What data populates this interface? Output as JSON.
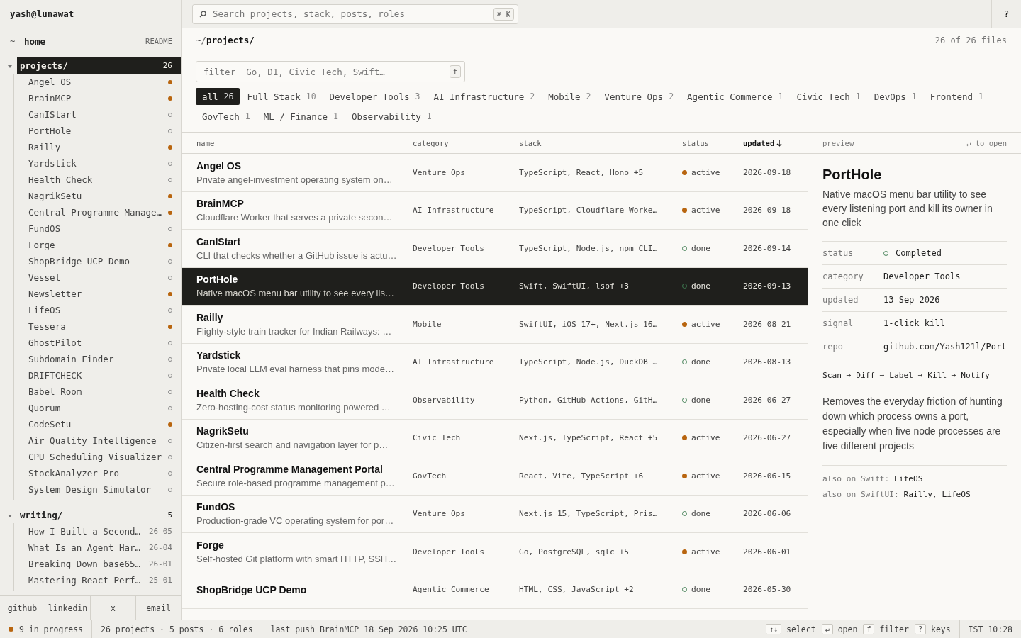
{
  "topbar": {
    "user": "yash@lunawat",
    "search": {
      "placeholder": "Search projects, stack, posts, roles",
      "shortcut": "⌘ K"
    },
    "help": "?"
  },
  "sidebar": {
    "home": {
      "icon": "~",
      "label": "home",
      "link": "README"
    },
    "sections": [
      {
        "label": "projects/",
        "count": "26",
        "expanded": true,
        "selected": true,
        "items": [
          {
            "kind": "project",
            "name": "Angel OS",
            "active": true
          },
          {
            "kind": "project",
            "name": "BrainMCP",
            "active": true
          },
          {
            "kind": "project",
            "name": "CanIStart",
            "active": false
          },
          {
            "kind": "project",
            "name": "PortHole",
            "active": false
          },
          {
            "kind": "project",
            "name": "Railly",
            "active": true
          },
          {
            "kind": "project",
            "name": "Yardstick",
            "active": false
          },
          {
            "kind": "project",
            "name": "Health Check",
            "active": false
          },
          {
            "kind": "project",
            "name": "NagrikSetu",
            "active": true
          },
          {
            "kind": "project",
            "name": "Central Programme Manage…",
            "active": true
          },
          {
            "kind": "project",
            "name": "FundOS",
            "active": false
          },
          {
            "kind": "project",
            "name": "Forge",
            "active": true
          },
          {
            "kind": "project",
            "name": "ShopBridge UCP Demo",
            "active": false
          },
          {
            "kind": "project",
            "name": "Vessel",
            "active": false
          },
          {
            "kind": "project",
            "name": "Newsletter",
            "active": true
          },
          {
            "kind": "project",
            "name": "LifeOS",
            "active": false
          },
          {
            "kind": "project",
            "name": "Tessera",
            "active": true
          },
          {
            "kind": "project",
            "name": "GhostPilot",
            "active": false
          },
          {
            "kind": "project",
            "name": "Subdomain Finder",
            "active": false
          },
          {
            "kind": "project",
            "name": "DRIFTCHECK",
            "active": false
          },
          {
            "kind": "project",
            "name": "Babel Room",
            "active": false
          },
          {
            "kind": "project",
            "name": "Quorum",
            "active": false
          },
          {
            "kind": "project",
            "name": "CodeSetu",
            "active": true
          },
          {
            "kind": "project",
            "name": "Air Quality Intelligence",
            "active": false
          },
          {
            "kind": "project",
            "name": "CPU Scheduling Visualizer",
            "active": false
          },
          {
            "kind": "project",
            "name": "StockAnalyzer Pro",
            "active": false
          },
          {
            "kind": "project",
            "name": "System Design Simulator",
            "active": false
          }
        ]
      },
      {
        "label": "writing/",
        "count": "5",
        "expanded": true,
        "selected": false,
        "items": [
          {
            "kind": "post",
            "name": "How I Built a Second…",
            "date": "26-05"
          },
          {
            "kind": "post",
            "name": "What Is an Agent Har…",
            "date": "26-04"
          },
          {
            "kind": "post",
            "name": "Breaking Down base65…",
            "date": "26-01"
          },
          {
            "kind": "post",
            "name": "Mastering React Perf…",
            "date": "25-01"
          }
        ]
      }
    ],
    "links": [
      "github",
      "linkedin",
      "x",
      "email"
    ]
  },
  "pathbar": {
    "path": "~/**projects/**",
    "count": "26 of 26 files"
  },
  "filter": {
    "placeholder": "filter  Go, D1, Civic Tech, Swift…",
    "key": "f"
  },
  "chips": [
    {
      "label": "all",
      "count": "26",
      "selected": true
    },
    {
      "label": "Full Stack",
      "count": "10",
      "selected": false
    },
    {
      "label": "Developer Tools",
      "count": "3",
      "selected": false
    },
    {
      "label": "AI Infrastructure",
      "count": "2",
      "selected": false
    },
    {
      "label": "Mobile",
      "count": "2",
      "selected": false
    },
    {
      "label": "Venture Ops",
      "count": "2",
      "selected": false
    },
    {
      "label": "Agentic Commerce",
      "count": "1",
      "selected": false
    },
    {
      "label": "Civic Tech",
      "count": "1",
      "selected": false
    },
    {
      "label": "DevOps",
      "count": "1",
      "selected": false
    },
    {
      "label": "Frontend",
      "count": "1",
      "selected": false
    },
    {
      "label": "GovTech",
      "count": "1",
      "selected": false
    },
    {
      "label": "ML / Finance",
      "count": "1",
      "selected": false
    },
    {
      "label": "Observability",
      "count": "1",
      "selected": false
    }
  ],
  "table": {
    "columns": [
      {
        "label": "name",
        "sorted": false
      },
      {
        "label": "category",
        "sorted": false
      },
      {
        "label": "stack",
        "sorted": false
      },
      {
        "label": "status",
        "sorted": false
      },
      {
        "label": "updated",
        "sorted": true
      }
    ],
    "rows": [
      {
        "name": "Angel OS",
        "desc": "Private angel-investment operating system on…",
        "category": "Venture Ops",
        "stack": "TypeScript, React, Hono +5",
        "status": "active",
        "updated": "2026-09-18",
        "selected": false
      },
      {
        "name": "BrainMCP",
        "desc": "Cloudflare Worker that serves a private secon…",
        "category": "AI Infrastructure",
        "stack": "TypeScript, Cloudflare Worke…",
        "status": "active",
        "updated": "2026-09-18",
        "selected": false
      },
      {
        "name": "CanIStart",
        "desc": "CLI that checks whether a GitHub issue is actu…",
        "category": "Developer Tools",
        "stack": "TypeScript, Node.js, npm CLI…",
        "status": "done",
        "updated": "2026-09-14",
        "selected": false
      },
      {
        "name": "PortHole",
        "desc": "Native macOS menu bar utility to see every lis…",
        "category": "Developer Tools",
        "stack": "Swift, SwiftUI, lsof +3",
        "status": "done",
        "updated": "2026-09-13",
        "selected": true
      },
      {
        "name": "Railly",
        "desc": "Flighty-style train tracker for Indian Railways: …",
        "category": "Mobile",
        "stack": "SwiftUI, iOS 17+, Next.js 16…",
        "status": "active",
        "updated": "2026-08-21",
        "selected": false
      },
      {
        "name": "Yardstick",
        "desc": "Private local LLM eval harness that pins mode…",
        "category": "AI Infrastructure",
        "stack": "TypeScript, Node.js, DuckDB …",
        "status": "done",
        "updated": "2026-08-13",
        "selected": false
      },
      {
        "name": "Health Check",
        "desc": "Zero-hosting-cost status monitoring powered …",
        "category": "Observability",
        "stack": "Python, GitHub Actions, GitH…",
        "status": "done",
        "updated": "2026-06-27",
        "selected": false
      },
      {
        "name": "NagrikSetu",
        "desc": "Citizen-first search and navigation layer for p…",
        "category": "Civic Tech",
        "stack": "Next.js, TypeScript, React +5",
        "status": "active",
        "updated": "2026-06-27",
        "selected": false
      },
      {
        "name": "Central Programme Management Portal",
        "desc": "Secure role-based programme management p…",
        "category": "GovTech",
        "stack": "React, Vite, TypeScript +6",
        "status": "active",
        "updated": "2026-06-15",
        "selected": false
      },
      {
        "name": "FundOS",
        "desc": "Production-grade VC operating system for por…",
        "category": "Venture Ops",
        "stack": "Next.js 15, TypeScript, Pris…",
        "status": "done",
        "updated": "2026-06-06",
        "selected": false
      },
      {
        "name": "Forge",
        "desc": "Self-hosted Git platform with smart HTTP, SSH…",
        "category": "Developer Tools",
        "stack": "Go, PostgreSQL, sqlc +5",
        "status": "active",
        "updated": "2026-06-01",
        "selected": false
      },
      {
        "name": "ShopBridge UCP Demo",
        "category": "Agentic Commerce",
        "stack": "HTML, CSS, JavaScript +2",
        "status": "done",
        "updated": "2026-05-30",
        "selected": false
      }
    ]
  },
  "preview": {
    "label": "preview",
    "hint": "↵ to open",
    "title": "PortHole",
    "desc": "Native macOS menu bar utility to see every listening port and kill its owner in one click",
    "fields": [
      {
        "label": "status",
        "value": "Completed",
        "kind": "status"
      },
      {
        "label": "category",
        "value": "Developer Tools",
        "kind": "text"
      },
      {
        "label": "updated",
        "value": "13 Sep 2026",
        "kind": "text"
      },
      {
        "label": "signal",
        "value": "1-click kill",
        "kind": "text"
      },
      {
        "label": "repo",
        "value": "github.com/Yash121l/Port",
        "kind": "text"
      }
    ],
    "flow": "Scan → Diff → Label → Kill → Notify",
    "summary": "Removes the everyday friction of hunting down which process owns a port, especially when five node processes are five different projects",
    "related": [
      {
        "label": "also on Swift:",
        "value": "LifeOS"
      },
      {
        "label": "also on SwiftUI:",
        "value": "Railly, LifeOS"
      }
    ]
  },
  "statusbar": {
    "progress": "9 in progress",
    "counts": "26 projects · 5 posts · 6 roles",
    "push": "last push BrainMCP 18 Sep 2026 10:25 UTC",
    "keys": [
      {
        "key": "↑↓",
        "label": "select"
      },
      {
        "key": "↵",
        "label": "open"
      },
      {
        "key": "f",
        "label": "filter"
      },
      {
        "key": "?",
        "label": "keys"
      }
    ],
    "clock": "IST 10:28"
  }
}
